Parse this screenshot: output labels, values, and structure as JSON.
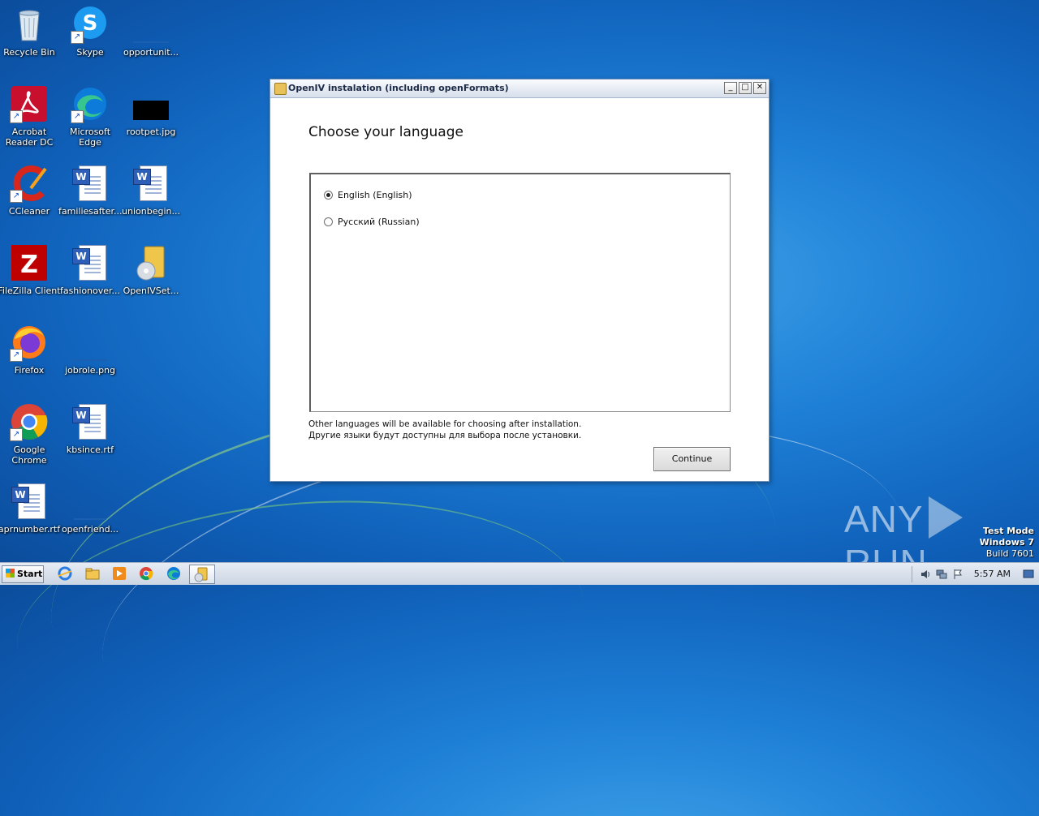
{
  "desktop": {
    "icons": [
      {
        "label": "Recycle Bin",
        "icon": "recycle-bin-icon"
      },
      {
        "label": "Skype",
        "icon": "skype-icon"
      },
      {
        "label": "opportunit...",
        "icon": "image-file-icon"
      },
      {
        "label": "Acrobat Reader DC",
        "icon": "acrobat-icon"
      },
      {
        "label": "Microsoft Edge",
        "icon": "edge-icon"
      },
      {
        "label": "rootpet.jpg",
        "icon": "image-file-icon"
      },
      {
        "label": "CCleaner",
        "icon": "ccleaner-icon"
      },
      {
        "label": "familiesafter...",
        "icon": "word-doc-icon"
      },
      {
        "label": "unionbegin...",
        "icon": "word-doc-icon"
      },
      {
        "label": "FileZilla Client",
        "icon": "filezilla-icon"
      },
      {
        "label": "fashionover...",
        "icon": "word-doc-icon"
      },
      {
        "label": "OpenIVSet...",
        "icon": "installer-icon"
      },
      {
        "label": "Firefox",
        "icon": "firefox-icon"
      },
      {
        "label": "jobrole.png",
        "icon": "image-file-icon"
      },
      {
        "label": "Google Chrome",
        "icon": "chrome-icon"
      },
      {
        "label": "kbsince.rtf",
        "icon": "word-doc-icon"
      },
      {
        "label": "aprnumber.rtf",
        "icon": "word-doc-icon"
      },
      {
        "label": "openfriend...",
        "icon": "image-file-icon"
      }
    ]
  },
  "window": {
    "title": "OpenIV instalation (including openFormats)",
    "heading": "Choose your language",
    "languages": [
      {
        "label": "English (English)",
        "selected": true
      },
      {
        "label": "Русский (Russian)",
        "selected": false
      }
    ],
    "note_line1": "Other languages will be available for choosing after installation.",
    "note_line2": "Другие языки будут доступны для выбора после установки.",
    "continue_label": "Continue",
    "min_symbol": "_",
    "max_symbol": "□",
    "close_symbol": "✕"
  },
  "watermark": {
    "left": "ANY",
    "right": "RUN"
  },
  "test_mode": {
    "line1": "Test Mode",
    "line2": "Windows 7",
    "line3": "Build 7601"
  },
  "taskbar": {
    "start_label": "Start",
    "clock": "5:57 AM",
    "pinned": [
      "ie-icon",
      "explorer-icon",
      "media-player-icon",
      "chrome-icon",
      "edge-icon",
      "openiv-installer-icon"
    ]
  }
}
